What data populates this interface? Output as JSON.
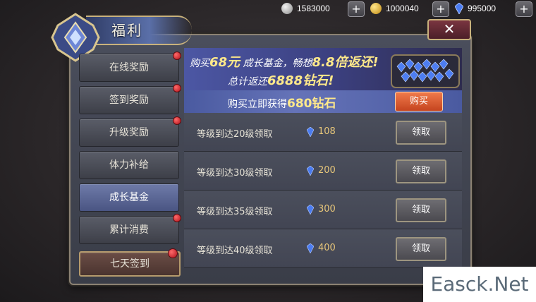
{
  "currency": {
    "silver": "1583000",
    "gold": "1000040",
    "diamond": "995000",
    "plus": "+"
  },
  "window": {
    "title": "福利",
    "close": "✕"
  },
  "sidebar": {
    "items": [
      {
        "label": "在线奖励"
      },
      {
        "label": "签到奖励"
      },
      {
        "label": "升级奖励"
      },
      {
        "label": "体力补给"
      },
      {
        "label": "成长基金"
      },
      {
        "label": "累计消费"
      },
      {
        "label": "七天签到"
      }
    ]
  },
  "banner": {
    "line1_pre": "购买",
    "line1_price": "68元",
    "line1_mid": " 成长基金，畅想",
    "line1_mult": "8.8倍返还!",
    "line2_pre": "总计返还",
    "line2_amount": "6888钻石!",
    "buy_pre": "购买立即获得",
    "buy_amount": "680钻石",
    "buy_button": "购买"
  },
  "rewards": [
    {
      "label": "等级到达20级领取",
      "value": "108",
      "button": "领取"
    },
    {
      "label": "等级到达30级领取",
      "value": "200",
      "button": "领取"
    },
    {
      "label": "等级到达35级领取",
      "value": "300",
      "button": "领取"
    },
    {
      "label": "等级到达40级领取",
      "value": "400",
      "button": "领取"
    }
  ],
  "watermark": "Easck.Net",
  "colors": {
    "accent_gold": "#c9b27c",
    "diamond_blue": "#3f6fe0",
    "buy_orange": "#e0602f"
  }
}
